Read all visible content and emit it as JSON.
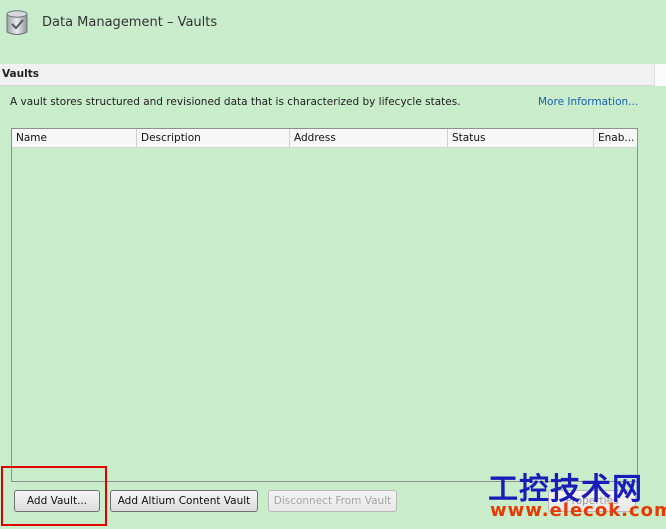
{
  "header": {
    "title": "Data Management – Vaults",
    "icon": "vault-check-icon"
  },
  "section": {
    "title": "Vaults"
  },
  "description": "A vault stores structured and revisioned data that is characterized by lifecycle states.",
  "more_info": "More Information...",
  "grid": {
    "columns": [
      "Name",
      "Description",
      "Address",
      "Status",
      "Enab..."
    ],
    "rows": []
  },
  "buttons": {
    "add_vault": "Add Vault...",
    "add_altium": "Add Altium Content Vault",
    "disconnect": "Disconnect From Vault",
    "properties": "Properties"
  },
  "watermark": {
    "line1": "工控技术网",
    "line2": "www.elecok.com"
  },
  "colors": {
    "background": "#c9eccb",
    "link": "#1a5fb4",
    "highlight": "#e00000"
  }
}
